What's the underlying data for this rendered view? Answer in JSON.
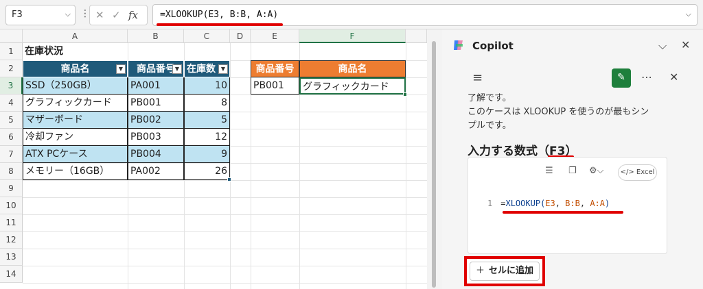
{
  "formula_bar": {
    "name_box": "F3",
    "fx_label": "fx",
    "formula": "=XLOOKUP(E3, B:B, A:A)"
  },
  "sheet": {
    "columns": [
      "A",
      "B",
      "C",
      "D",
      "E",
      "F"
    ],
    "rows": [
      "1",
      "2",
      "3",
      "4",
      "5",
      "6",
      "7",
      "8",
      "9",
      "10",
      "11",
      "12",
      "13",
      "14"
    ],
    "title": "在庫状況",
    "table_headers": [
      "商品名",
      "商品番号",
      "在庫数"
    ],
    "table_rows": [
      [
        "SSD（250GB）",
        "PA001",
        "10"
      ],
      [
        "グラフィックカード",
        "PB001",
        "8"
      ],
      [
        "マザーボード",
        "PB002",
        "5"
      ],
      [
        "冷却ファン",
        "PB003",
        "12"
      ],
      [
        "ATX PCケース",
        "PB004",
        "9"
      ],
      [
        "メモリー（16GB）",
        "PA002",
        "26"
      ]
    ],
    "lookup_headers": [
      "商品番号",
      "商品名"
    ],
    "lookup_row": [
      "PB001",
      "グラフィックカード"
    ]
  },
  "copilot": {
    "title": "Copilot",
    "message_line1": "了解です。",
    "message_line2": "このケースは XLOOKUP を使うのが最もシン",
    "message_line3": "プルです。",
    "heading": "入力する数式（F3）",
    "code_line_no": "1",
    "code_eq": "=",
    "code_fn": "XLOOKUP(",
    "code_arg1": "E3",
    "code_sep1": ", ",
    "code_arg2": "B:B",
    "code_sep2": ", ",
    "code_arg3": "A:A",
    "code_close": ")",
    "excel_pill": "Excel",
    "add_button": "セルに追加"
  },
  "colors": {
    "table_header": "#1f5a7a",
    "band": "#bfe3f2",
    "lookup_header": "#ed7d31",
    "excel_green": "#217346",
    "highlight_red": "#e00000"
  }
}
